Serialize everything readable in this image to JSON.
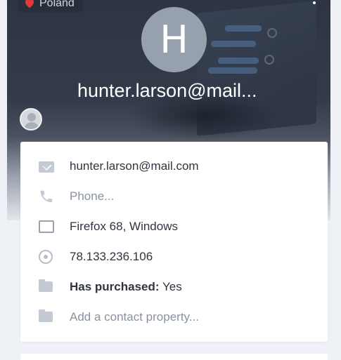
{
  "location": {
    "country": "Poland"
  },
  "contact": {
    "avatar_initial": "H",
    "title": "hunter.larson@mail..."
  },
  "details": {
    "email": "hunter.larson@mail.com",
    "phone_placeholder": "Phone...",
    "device": "Firefox 68, Windows",
    "ip": "78.133.236.106",
    "purchased_label": "Has purchased:",
    "purchased_value": "Yes",
    "add_property": "Add a contact property..."
  },
  "colors": {
    "pin": "#e23a3a",
    "avatar_bg": "#97a1ae",
    "card_bg": "#ffffff",
    "page_bg": "#eef1f6"
  }
}
